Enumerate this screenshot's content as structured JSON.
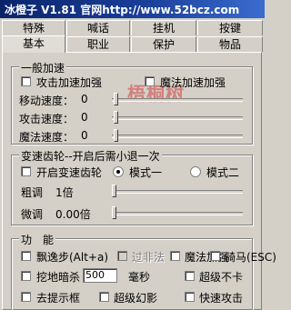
{
  "window": {
    "title": "冰橙子 V1.81 官网http://www.52bcz.com"
  },
  "watermark": "梧桐树",
  "tabs_row1": [
    "特殊",
    "喊话",
    "挂机",
    "按键"
  ],
  "tabs_row2": [
    "基本",
    "职业",
    "保护",
    "物品"
  ],
  "active_tab": "基本",
  "accel": {
    "legend": "一般加速",
    "attack_boost_label": "攻击加速加强",
    "magic_boost_label": "魔法加速加强",
    "move_speed_label": "移动速度：",
    "move_speed_value": "0",
    "attack_speed_label": "攻击速度：",
    "attack_speed_value": "0",
    "magic_speed_label": "魔法速度：",
    "magic_speed_value": "0"
  },
  "gear": {
    "legend": "变速齿轮--开启后需小退一次",
    "enable_label": "开启变速齿轮",
    "mode1_label": "模式一",
    "mode2_label": "模式二",
    "selected_mode": "模式一",
    "coarse_label": "粗调",
    "coarse_value": "1倍",
    "fine_label": "微调",
    "fine_value": "0.00倍"
  },
  "functions": {
    "legend": "功　能",
    "float_step_label": "飘逸步(Alt+a)",
    "pass_through_label": "过非法",
    "magic_boost_label": "魔法加强",
    "ride_label": "骑马(ESC)",
    "dig_kill_label": "挖地暗杀",
    "dig_kill_value": "500",
    "ms_unit": "毫秒",
    "super_nolag_label": "超级不卡",
    "remove_hint_label": "去提示框",
    "super_illusion_label": "超级幻影",
    "fast_attack_label": "快速攻击"
  }
}
